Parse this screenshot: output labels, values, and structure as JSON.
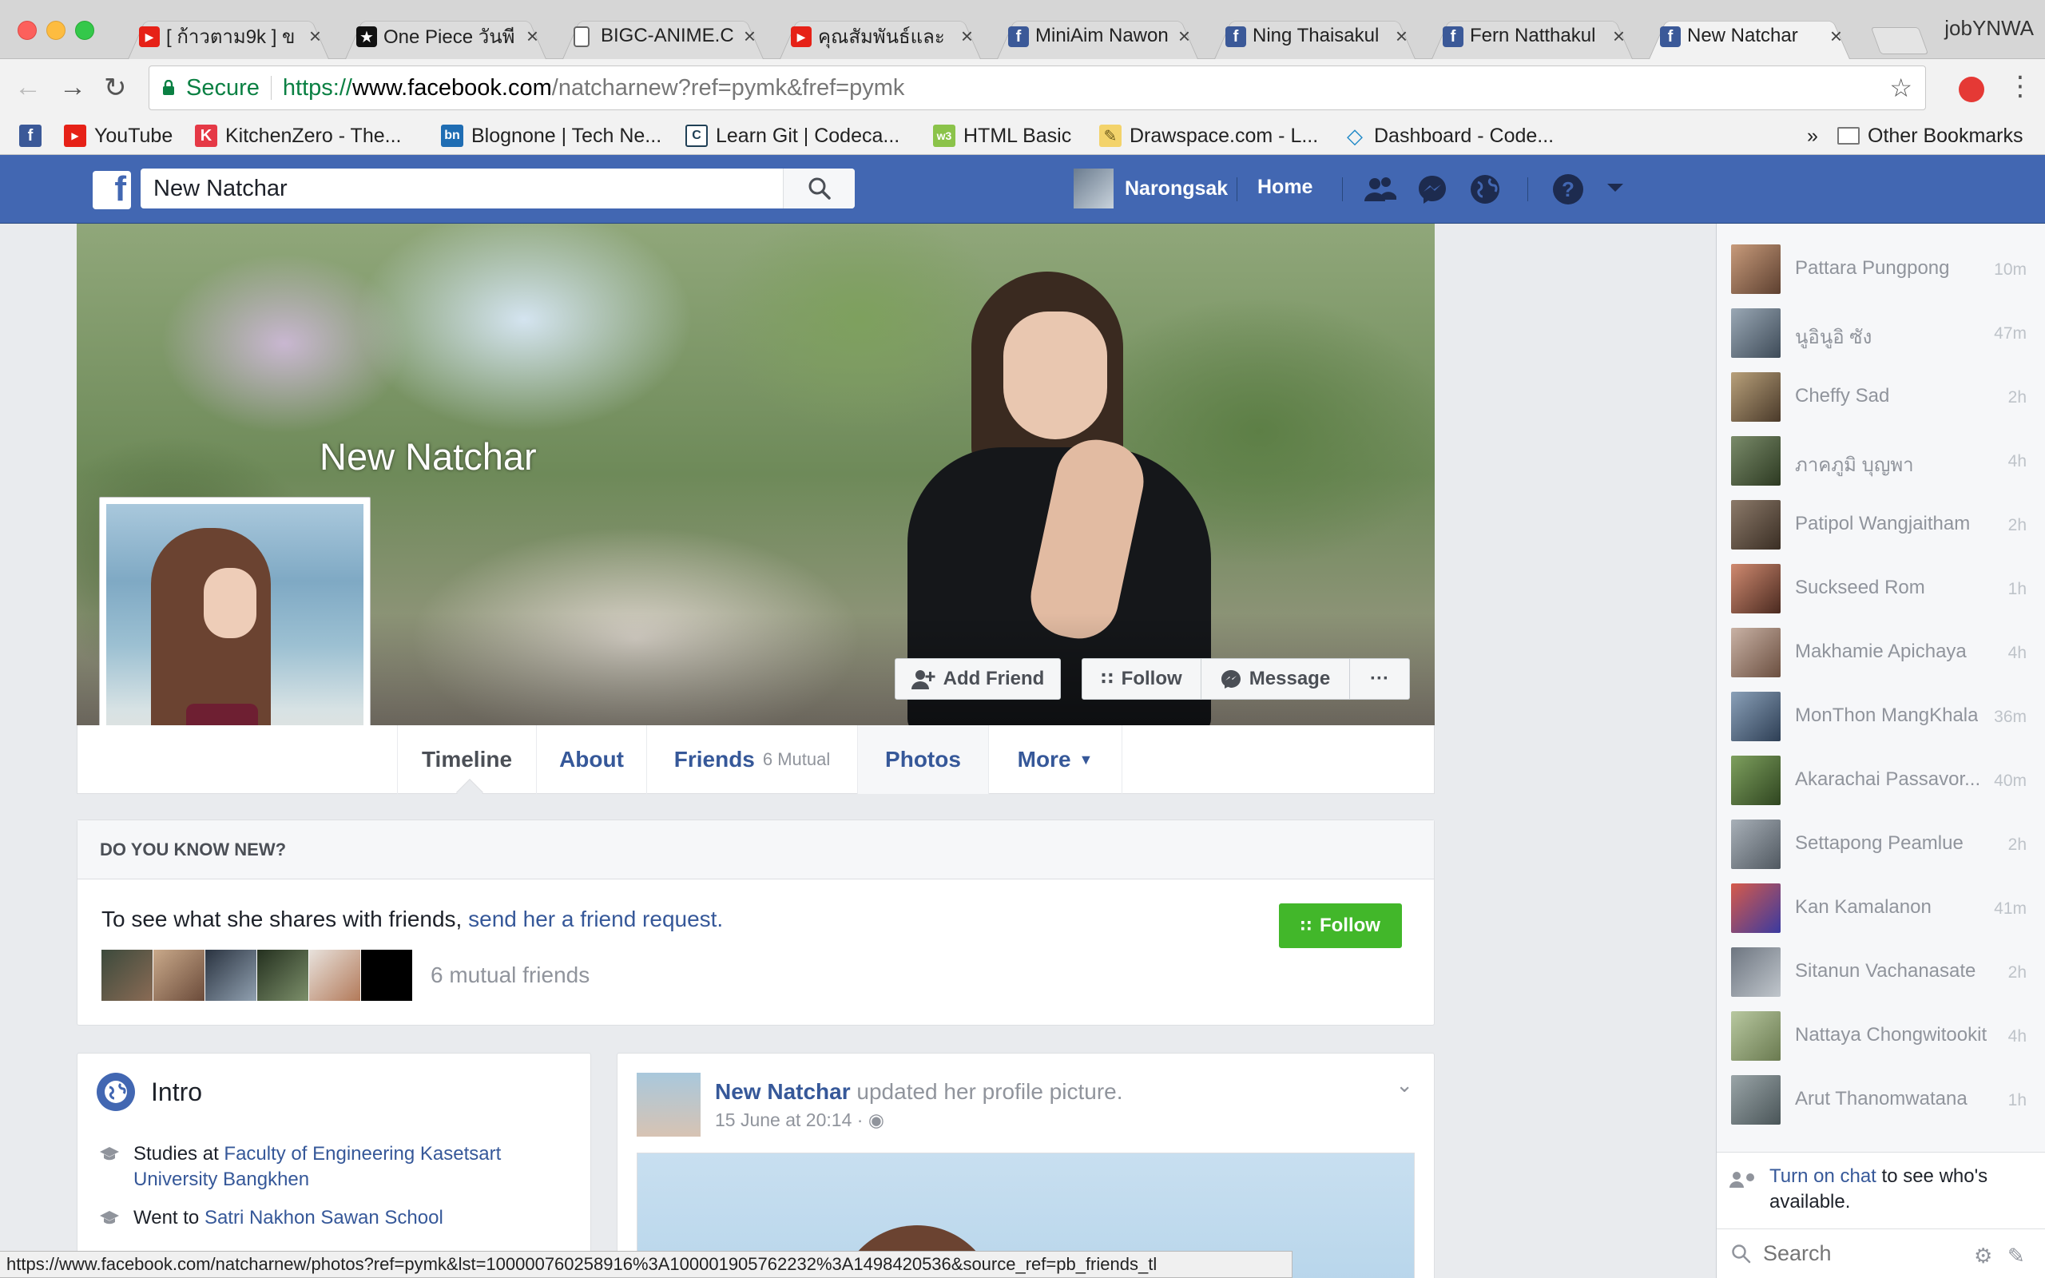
{
  "browser": {
    "tabs": [
      {
        "title": "[ ก้าวตาม9k ] ข",
        "favicon": "youtube"
      },
      {
        "title": "One Piece วันพี",
        "favicon": "star"
      },
      {
        "title": "BIGC-ANIME.C",
        "favicon": "page"
      },
      {
        "title": "คุณสัมพันธ์และ",
        "favicon": "youtube"
      },
      {
        "title": "MiniAim Nawon",
        "favicon": "facebook"
      },
      {
        "title": "Ning Thaisakul",
        "favicon": "facebook"
      },
      {
        "title": "Fern Natthakul",
        "favicon": "facebook"
      },
      {
        "title": "New Natchar",
        "favicon": "facebook"
      }
    ],
    "profile_name": "jobYNWA",
    "secure_label": "Secure",
    "url_scheme": "https://",
    "url_host": "www.facebook.com",
    "url_path": "/natcharnew?ref=pymk&fref=pymk",
    "bookmarks": [
      {
        "label": "",
        "icon": "facebook-icon"
      },
      {
        "label": "YouTube",
        "icon": "youtube-icon"
      },
      {
        "label": "KitchenZero - The...",
        "icon": "k-icon"
      },
      {
        "label": "Blognone | Tech Ne...",
        "icon": "bn-icon"
      },
      {
        "label": "Learn Git | Codeca...",
        "icon": "codecademy-icon"
      },
      {
        "label": "HTML Basic",
        "icon": "w3-icon"
      },
      {
        "label": "Drawspace.com - L...",
        "icon": "pencil-icon"
      },
      {
        "label": "Dashboard - Code...",
        "icon": "code-icon"
      }
    ],
    "bookmarks_overflow": "»",
    "other_bookmarks": "Other Bookmarks",
    "status_url": "https://www.facebook.com/natcharnew/photos?ref=pymk&lst=100000760258916%3A100001905762232%3A1498420536&source_ref=pb_friends_tl"
  },
  "fb_header": {
    "search_value": "New Natchar",
    "user_name": "Narongsak",
    "home_label": "Home"
  },
  "profile": {
    "name": "New Natchar",
    "buttons": {
      "add_friend": "Add Friend",
      "follow": "Follow",
      "message": "Message",
      "more": "···"
    },
    "nav": {
      "timeline": "Timeline",
      "about": "About",
      "friends": "Friends",
      "friends_sub": "6 Mutual",
      "photos": "Photos",
      "more": "More"
    }
  },
  "dyk": {
    "heading": "DO YOU KNOW NEW?",
    "text_prefix": "To see what she shares with friends, ",
    "text_link": "send her a friend request.",
    "mutual_text": "6 mutual friends",
    "follow_label": "Follow"
  },
  "intro": {
    "title": "Intro",
    "studies_prefix": "Studies at ",
    "studies_link": "Faculty of Engineering Kasetsart University Bangkhen",
    "went_prefix": "Went to ",
    "went_link": "Satri Nakhon Sawan School"
  },
  "post": {
    "author": "New Natchar",
    "action": " updated her profile picture.",
    "time": "15 June at 20:14 · "
  },
  "chat": {
    "contacts": [
      {
        "name": "Pattara Pungpong",
        "time": "10m"
      },
      {
        "name": "นูอินูอิ ซัง",
        "time": "47m"
      },
      {
        "name": "Cheffy Sad",
        "time": "2h"
      },
      {
        "name": "ภาคภูมิ บุญพา",
        "time": "4h"
      },
      {
        "name": "Patipol Wangjaitham",
        "time": "2h"
      },
      {
        "name": "Suckseed Rom",
        "time": "1h"
      },
      {
        "name": "Makhamie Apichaya",
        "time": "4h"
      },
      {
        "name": "MonThon MangKhala",
        "time": "36m"
      },
      {
        "name": "Akarachai Passavor...",
        "time": "40m"
      },
      {
        "name": "Settapong Peamlue",
        "time": "2h"
      },
      {
        "name": "Kan Kamalanon",
        "time": "41m"
      },
      {
        "name": "Sitanun Vachanasate",
        "time": "2h"
      },
      {
        "name": "Nattaya Chongwitookit",
        "time": "4h"
      },
      {
        "name": "Arut Thanomwatana",
        "time": "1h"
      }
    ],
    "notice_link": "Turn on chat",
    "notice_rest": " to see who's available.",
    "search_placeholder": "Search"
  },
  "colors": {
    "fb_blue": "#4267b2",
    "link": "#365899",
    "follow_green": "#42b72a",
    "secure_green": "#0b8043"
  }
}
